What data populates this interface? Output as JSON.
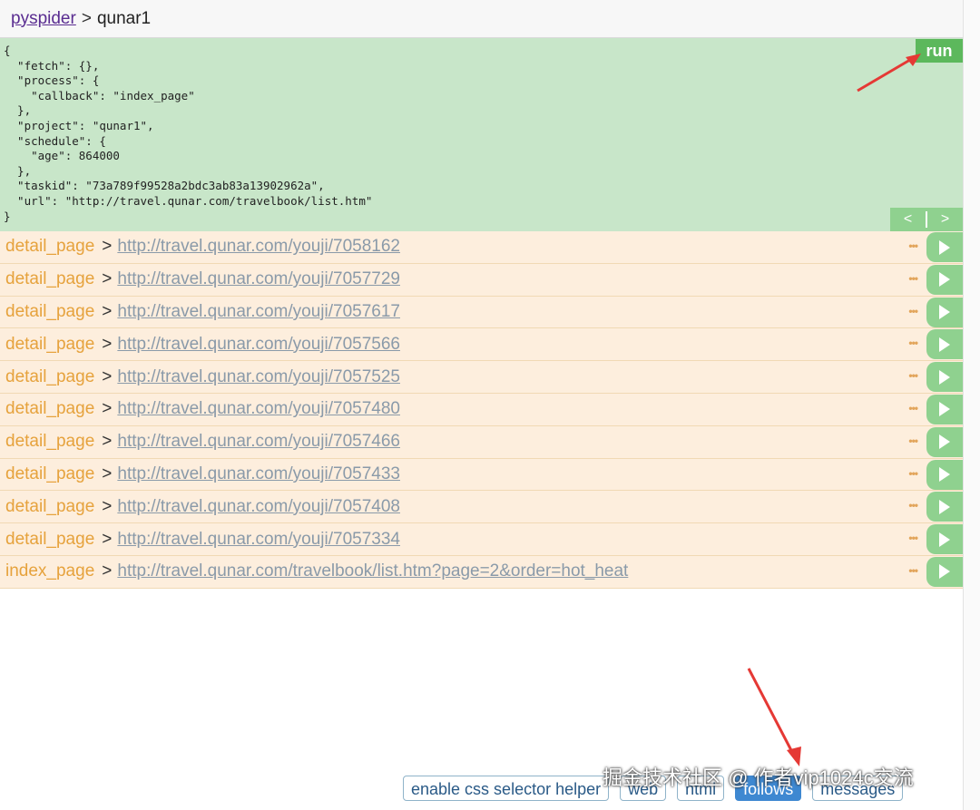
{
  "breadcrumb": {
    "root": "pyspider",
    "separator": ">",
    "project": "qunar1"
  },
  "task_json_lines": [
    "{",
    "  \"fetch\": {},",
    "  \"process\": {",
    "    \"callback\": \"index_page\"",
    "  },",
    "  \"project\": \"qunar1\",",
    "  \"schedule\": {",
    "    \"age\": 864000",
    "  },",
    "  \"taskid\": \"73a789f99528a2bdc3ab83a13902962a\",",
    "  \"url\": \"http://travel.qunar.com/travelbook/list.htm\"",
    "}"
  ],
  "run_label": "run",
  "pager": {
    "prev": "<",
    "next": ">"
  },
  "follows": [
    {
      "callback": "detail_page",
      "url": "http://travel.qunar.com/youji/7058162"
    },
    {
      "callback": "detail_page",
      "url": "http://travel.qunar.com/youji/7057729"
    },
    {
      "callback": "detail_page",
      "url": "http://travel.qunar.com/youji/7057617"
    },
    {
      "callback": "detail_page",
      "url": "http://travel.qunar.com/youji/7057566"
    },
    {
      "callback": "detail_page",
      "url": "http://travel.qunar.com/youji/7057525"
    },
    {
      "callback": "detail_page",
      "url": "http://travel.qunar.com/youji/7057480"
    },
    {
      "callback": "detail_page",
      "url": "http://travel.qunar.com/youji/7057466"
    },
    {
      "callback": "detail_page",
      "url": "http://travel.qunar.com/youji/7057433"
    },
    {
      "callback": "detail_page",
      "url": "http://travel.qunar.com/youji/7057408"
    },
    {
      "callback": "detail_page",
      "url": "http://travel.qunar.com/youji/7057334"
    },
    {
      "callback": "index_page",
      "url": "http://travel.qunar.com/travelbook/list.htm?page=2&order=hot_heat"
    }
  ],
  "follow_separator": ">",
  "more_icon": "more-dots-icon",
  "play_icon": "play-icon",
  "tabs": {
    "css_helper": "enable css selector helper",
    "web": "web",
    "html": "html",
    "follows": "follows",
    "messages": "messages"
  },
  "watermark": "掘金技术社区 @ 作者vip1024c交流",
  "colors": {
    "run": "#5cb85c",
    "task_bg": "#c8e6c9",
    "row_bg": "#fdeedd",
    "callback": "#e6a23c",
    "annotation": "#e53935"
  }
}
